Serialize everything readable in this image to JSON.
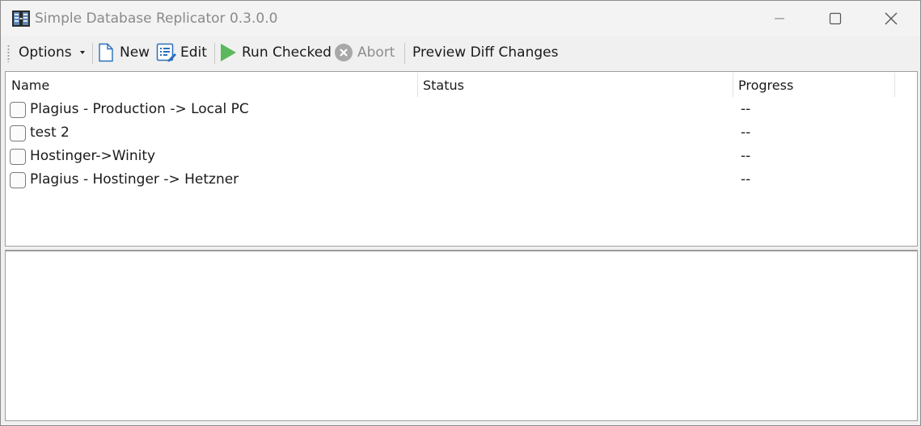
{
  "window": {
    "title": "Simple Database Replicator 0.3.0.0",
    "app_icon": "database-replicator-icon",
    "controls": [
      "minimize-icon",
      "maximize-icon",
      "close-icon"
    ]
  },
  "toolbar": {
    "options_label": "Options",
    "new_label": "New",
    "edit_label": "Edit",
    "run_checked_label": "Run Checked",
    "abort_label": "Abort",
    "preview_label": "Preview Diff Changes",
    "icons": {
      "new": "document-icon",
      "edit": "edit-list-icon",
      "run": "play-icon",
      "abort": "cancel-circle-icon"
    },
    "colors": {
      "run_icon": "#5cb85c",
      "edit_icon": "#2a6ebb",
      "new_icon": "#2a6ebb",
      "abort_icon": "#a0a0a0"
    }
  },
  "list": {
    "columns": [
      "Name",
      "Status",
      "Progress"
    ],
    "rows": [
      {
        "name": "Plagius - Production -> Local PC",
        "status": "",
        "progress": "--",
        "checked": false
      },
      {
        "name": "test 2",
        "status": "",
        "progress": "--",
        "checked": false
      },
      {
        "name": "Hostinger->Winity",
        "status": "",
        "progress": "--",
        "checked": false
      },
      {
        "name": "Plagius - Hostinger -> Hetzner",
        "status": "",
        "progress": "--",
        "checked": false
      }
    ]
  },
  "log": {
    "text": ""
  }
}
